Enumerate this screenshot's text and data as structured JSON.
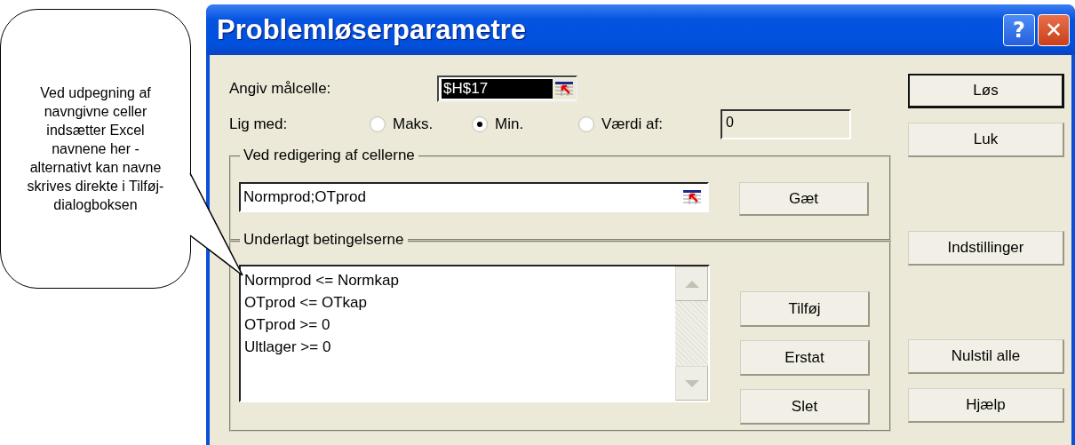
{
  "callout": {
    "text": "Ved udpegning af navngivne celler indsætter Excel navnene her - alternativt kan navne skrives direkte i Tilføj-dialogboksen"
  },
  "window": {
    "title": "Problemløserparametre",
    "help": "?",
    "close": "✕"
  },
  "target": {
    "label": "Angiv målcelle:",
    "value": "$H$17",
    "value_selected": true
  },
  "equal": {
    "label": "Lig med:",
    "options": [
      {
        "label": "Maks.",
        "selected": false
      },
      {
        "label": "Min.",
        "selected": true
      },
      {
        "label": "Værdi af:",
        "selected": false
      }
    ],
    "value": "0"
  },
  "changing": {
    "title": "Ved redigering af cellerne",
    "value": "Normprod;OTprod",
    "button": "Gæt"
  },
  "constraints": {
    "title": "Underlagt betingelserne",
    "items": [
      {
        "text": "Normprod <= Normkap",
        "selected": false
      },
      {
        "text": "OTprod <= OTkap",
        "selected": false
      },
      {
        "text": "OTprod >= 0",
        "selected": false
      },
      {
        "text": "Ultlager >= 0",
        "selected": false
      }
    ],
    "buttons": [
      "Tilføj",
      "Erstat",
      "Slet"
    ]
  },
  "side_buttons": [
    {
      "label": "Løs",
      "default": true
    },
    {
      "label": "Luk",
      "default": false
    },
    {
      "label": "Indstillinger",
      "default": false
    },
    {
      "label": "Nulstil alle",
      "default": false
    },
    {
      "label": "Hjælp",
      "default": false
    }
  ]
}
